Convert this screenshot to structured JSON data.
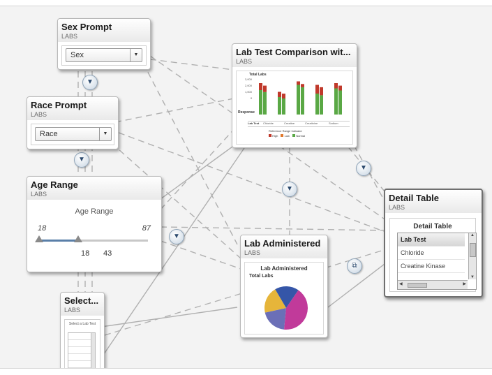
{
  "canvas": {
    "background": "#f3f3f3",
    "line_color": "#a9a9a9"
  },
  "nodes": {
    "sex_prompt": {
      "title": "Sex Prompt",
      "source": "LABS",
      "dropdown_value": "Sex",
      "arrow": "▼"
    },
    "race_prompt": {
      "title": "Race Prompt",
      "source": "LABS",
      "dropdown_value": "Race",
      "arrow": "▼"
    },
    "age_range": {
      "title": "Age Range",
      "source": "LABS",
      "slider_label": "Age Range",
      "min_label": "18",
      "max_label": "87",
      "low_value": "18",
      "high_value": "43",
      "selected_fraction_start": 0.0,
      "selected_fraction_end": 0.36
    },
    "lab_test_comparison": {
      "title": "Lab Test Comparison wit...",
      "source": "LABS",
      "chart_title": "Total Labs",
      "y_ticks": [
        "3,000",
        "2,000",
        "1,000",
        "0"
      ],
      "row_label": "Response",
      "categories": [
        "Lab Test",
        "Chloride",
        "Creatine",
        "Creatinine",
        "Sodium"
      ],
      "legend_title": "Reference Range Indicator",
      "legend_items": [
        "High",
        "Low",
        "Normal"
      ],
      "colors": {
        "high": "#c0392b",
        "low": "#e07a2f",
        "normal": "#5aa845"
      },
      "bars": [
        {
          "normal": 0.7,
          "high": 0.2
        },
        {
          "normal": 0.5,
          "high": 0.15
        },
        {
          "normal": 0.85,
          "high": 0.1
        },
        {
          "normal": 0.6,
          "high": 0.25
        },
        {
          "normal": 0.75,
          "high": 0.15
        }
      ]
    },
    "lab_administered": {
      "title": "Lab Administered",
      "source": "LABS",
      "chart_title": "Lab Administered",
      "measure": "Total Labs",
      "pie_colors": [
        "#c13a9a",
        "#6b6fb7",
        "#e6b53a",
        "#3556a8"
      ]
    },
    "detail_table": {
      "title": "Detail Table",
      "source": "LABS",
      "table_title": "Detail Table",
      "column_header": "Lab Test",
      "rows": [
        "Chloride",
        "Creatine Kinase"
      ]
    },
    "select_list": {
      "title": "Select...",
      "source": "LABS",
      "inner_label": "Select a Lab Test",
      "items": [
        "",
        "",
        "",
        "",
        ""
      ]
    }
  },
  "badges": {
    "filter_icon": "filter-funnel-icon",
    "filter_glyph": "▼",
    "link_icon": "link-icon",
    "link_glyph": "⧉"
  }
}
